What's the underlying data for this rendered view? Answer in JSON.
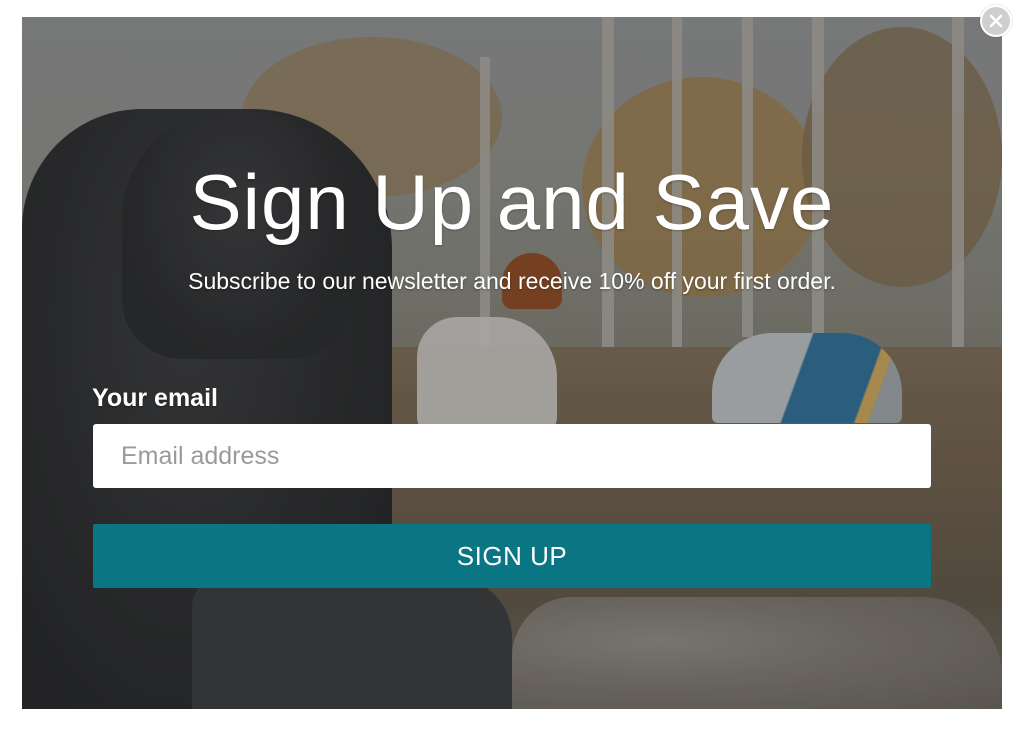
{
  "popup": {
    "title": "Sign Up and Save",
    "subtitle": "Subscribe to our newsletter and receive 10% off your first order.",
    "email_label": "Your email",
    "email_placeholder": "Email address",
    "email_value": "",
    "submit_label": "SIGN UP",
    "close_icon": "close-icon",
    "accent_color": "#0a7583"
  }
}
